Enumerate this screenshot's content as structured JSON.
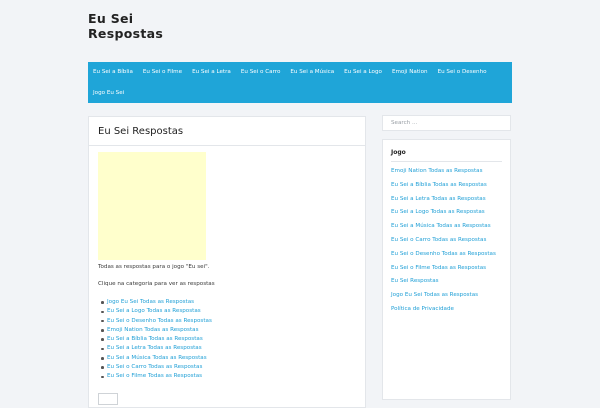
{
  "site": {
    "title_line1": "Eu Sei",
    "title_line2": "Respostas"
  },
  "nav": {
    "row1": [
      "Eu Sei a Bíblia",
      "Eu Sei o Filme",
      "Eu Sei a Letra",
      "Eu Sei o Carro",
      "Eu Sei a Música",
      "Eu Sei a Logo",
      "Emoji Nation",
      "Eu Sei o Desenho"
    ],
    "row2": [
      "Jogo Eu Sei"
    ]
  },
  "main": {
    "title": "Eu Sei Respostas",
    "intro": "Todas as respostas para o jogo \"Eu sei\".",
    "instruction": "Clique na categoria para ver as respostas",
    "categories": [
      "Jogo Eu Sei Todas as Respostas",
      "Eu Sei a Logo Todas as Respostas",
      "Eu Sei o Desenho Todas as Respostas",
      "Emoji Nation Todas as Respostas",
      "Eu Sei a Bíblia Todas as Respostas",
      "Eu Sei a Letra Todas as Respostas",
      "Eu Sei a Música Todas as Respostas",
      "Eu Sei o Carro Todas as Respostas",
      "Eu Sei o Filme Todas as Respostas"
    ]
  },
  "sidebar": {
    "search_placeholder": "Search ...",
    "widget_title": "Jogo",
    "links": [
      "Emoji Nation Todas as Respostas",
      "Eu Sei a Bíblia Todas as Respostas",
      "Eu Sei a Letra Todas as Respostas",
      "Eu Sei a Logo Todas as Respostas",
      "Eu Sei a Música Todas as Respostas",
      "Eu Sei o Carro Todas as Respostas",
      "Eu Sei o Desenho Todas as Respostas",
      "Eu Sei o Filme Todas as Respostas",
      "Eu Sei Respostas",
      "Jogo Eu Sei Todas as Respostas",
      "Política de Privacidade"
    ]
  },
  "colors": {
    "nav_bg": "#1fa5d8",
    "link": "#1f9fd6",
    "ad_bg": "#ffffcc",
    "page_bg": "#f2f4f7"
  }
}
